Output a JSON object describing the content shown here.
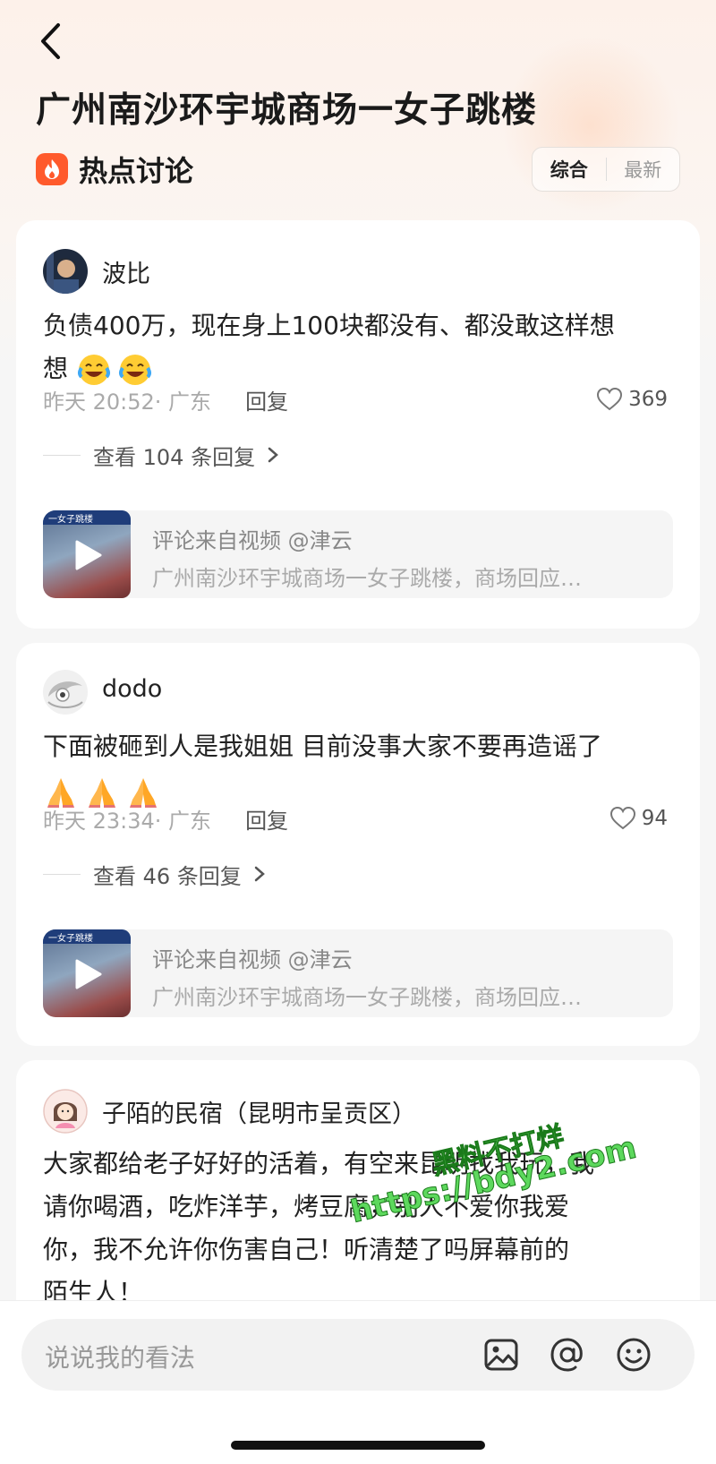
{
  "header": {
    "title": "广州南沙环宇城商场一女子跳楼",
    "section_label": "热点讨论",
    "sort_options": [
      "综合",
      "最新"
    ],
    "sort_selected": "综合"
  },
  "comments": [
    {
      "username": "波比",
      "text": "负债400万，现在身上100块都没有、都没敢这样想",
      "emojis": [
        "laughing-crying-emoji",
        "laughing-crying-emoji"
      ],
      "time": "昨天 20:52· 广东",
      "reply_label": "回复",
      "likes": "369",
      "replies_label": "查看 104 条回复",
      "video_source": "评论来自视频 @津云",
      "video_desc": "广州南沙环宇城商场一女子跳楼，商场回应…",
      "video_banner": "一女子跳楼"
    },
    {
      "username": "dodo",
      "text": "下面被砸到人是我姐姐 目前没事大家不要再造谣了",
      "emojis": [
        "praying-hands-emoji",
        "praying-hands-emoji",
        "praying-hands-emoji"
      ],
      "time": "昨天 23:34· 广东",
      "reply_label": "回复",
      "likes": "94",
      "replies_label": "查看 46 条回复",
      "video_source": "评论来自视频 @津云",
      "video_desc": "广州南沙环宇城商场一女子跳楼，商场回应…",
      "video_banner": "一女子跳楼"
    },
    {
      "username": "子陌的民宿（昆明市呈贡区）",
      "text_lines": [
        "大家都给老子好好的活着，有空来昆明找我玩，我",
        "请你喝酒，吃炸洋芋，烤豆腐，别人不爱你我爱",
        "你，我不允许你伤害自己！听清楚了吗屏幕前的",
        "陌生人！"
      ]
    }
  ],
  "watermark": {
    "line1": "黑料不打烊",
    "line2": "https://bdy2.com"
  },
  "bottom_bar": {
    "input_placeholder": "说说我的看法"
  },
  "colors": {
    "accent": "#ff5a2c",
    "watermark_green": "#5dd85d"
  }
}
